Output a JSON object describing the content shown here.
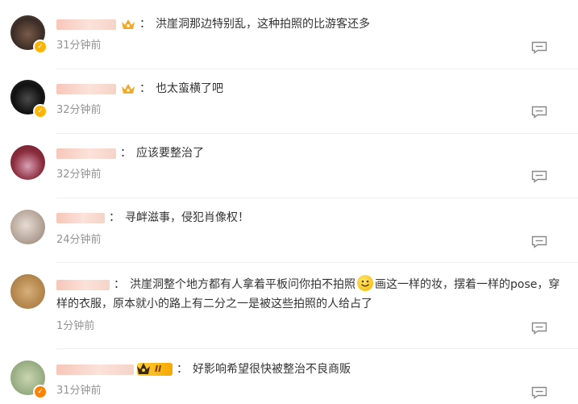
{
  "comments": [
    {
      "text": "洪崖洞那边特别乱，这种拍照的比游客还多",
      "time": "31分钟前",
      "badge": "crown",
      "verified": "gold"
    },
    {
      "text": "也太蛮横了吧",
      "time": "32分钟前",
      "badge": "crown",
      "verified": "gold"
    },
    {
      "text": "应该要整治了",
      "time": "32分钟前",
      "badge": "",
      "verified": ""
    },
    {
      "text": "寻衅滋事，侵犯肖像权！",
      "time": "24分钟前",
      "badge": "",
      "verified": ""
    },
    {
      "text_part1": "洪崖洞整个地方都有人拿着平板问你拍不拍照",
      "text_part2": "画这一样的妆，摆着一样的pose，穿",
      "text_line2": "样的衣服，原本就小的路上有二分之一是被这些拍照的人给占了",
      "time": "1分钟前",
      "badge": "",
      "verified": ""
    },
    {
      "text": "好影响希望很快被整治不良商贩",
      "time": "31分钟前",
      "badge": "level",
      "level_text": "II",
      "verified": "orange"
    }
  ],
  "colon": "：",
  "colors": {
    "time": "#939393",
    "verified_gold": "#ffb400",
    "verified_orange": "#ff8200"
  },
  "icons": {
    "reply": "comment-reply-icon",
    "crown": "crown-icon",
    "emoji": "smile-emoji-icon"
  }
}
